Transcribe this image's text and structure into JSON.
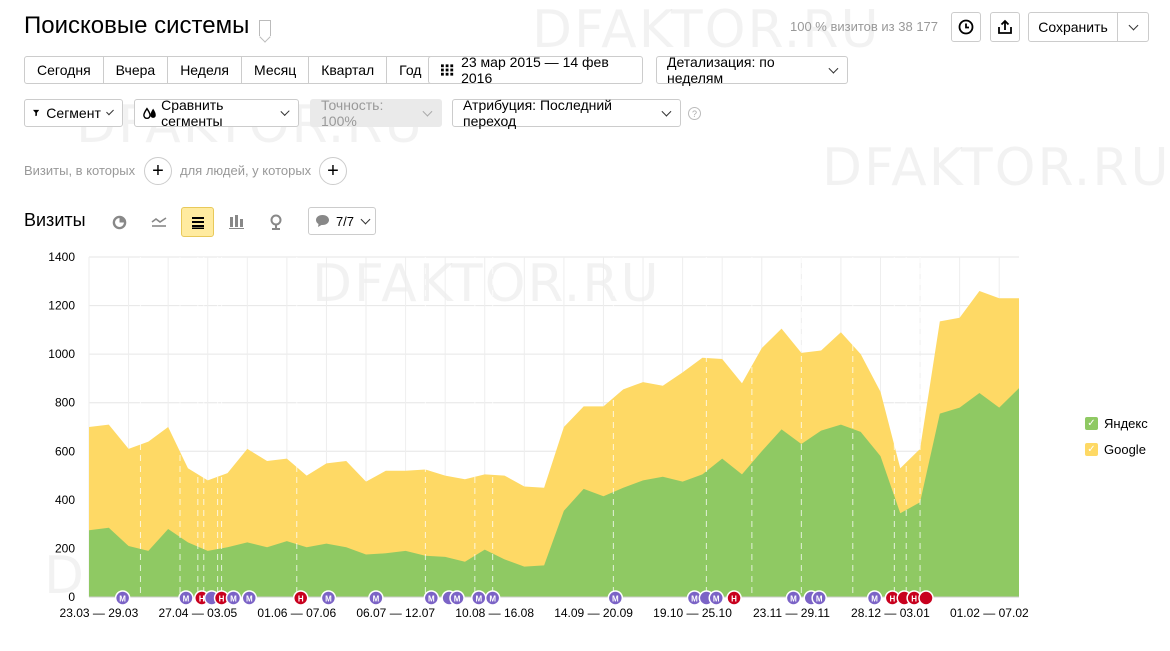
{
  "header": {
    "title": "Поисковые системы",
    "visits_note": "100 % визитов из 38 177",
    "save_label": "Сохранить"
  },
  "periods": [
    "Сегодня",
    "Вчера",
    "Неделя",
    "Месяц",
    "Квартал",
    "Год"
  ],
  "date_range": "23 мар 2015 — 14 фев 2016",
  "detail": "Детализация: по неделям",
  "filters": {
    "segment": "Сегмент",
    "compare": "Сравнить сегменты",
    "accuracy": "Точность: 100%",
    "attribution": "Атрибуция: Последний переход"
  },
  "conditions": {
    "visits_label": "Визиты, в которых",
    "people_label": "для людей, у которых"
  },
  "chart_header": {
    "title": "Визиты",
    "annotations": "7/7"
  },
  "watermarks": [
    "DFAKTOR.RU",
    "DFAKTOR.RU",
    "DFAKTOR.RU",
    "DFAKTOR.RU",
    "DFAKTOR.RU",
    "DFAKTOR.RU"
  ],
  "chart_data": {
    "type": "area",
    "stacked": true,
    "ylim": [
      0,
      1400
    ],
    "yticks": [
      0,
      200,
      400,
      600,
      800,
      1000,
      1200,
      1400
    ],
    "x_tick_labels": [
      "23.03 — 29.03",
      "27.04 — 03.05",
      "01.06 — 07.06",
      "06.07 — 12.07",
      "10.08 — 16.08",
      "14.09 — 20.09",
      "19.10 — 25.10",
      "23.11 — 29.11",
      "28.12 — 03.01",
      "01.02 — 07.02"
    ],
    "series": [
      {
        "name": "Яндекс",
        "color": "#8fc963",
        "values": [
          275,
          285,
          210,
          190,
          280,
          225,
          190,
          205,
          225,
          205,
          230,
          205,
          220,
          205,
          175,
          180,
          190,
          170,
          165,
          145,
          195,
          155,
          125,
          130,
          355,
          445,
          415,
          450,
          480,
          495,
          475,
          505,
          570,
          505,
          600,
          690,
          630,
          685,
          710,
          680,
          580,
          345,
          390,
          755,
          780,
          840,
          780,
          860
        ]
      },
      {
        "name": "Google",
        "color": "#fed965",
        "values": [
          425,
          425,
          400,
          450,
          420,
          305,
          290,
          305,
          385,
          355,
          340,
          295,
          330,
          355,
          300,
          340,
          330,
          355,
          335,
          340,
          310,
          345,
          330,
          320,
          345,
          340,
          370,
          405,
          405,
          375,
          450,
          480,
          410,
          375,
          425,
          415,
          375,
          330,
          380,
          320,
          265,
          185,
          220,
          380,
          370,
          420,
          450,
          370
        ]
      }
    ],
    "annotation_markers": [
      {
        "week": 1.7,
        "letter": "М",
        "type": "М"
      },
      {
        "week": 4.9,
        "letter": "М",
        "type": "М"
      },
      {
        "week": 5.7,
        "letter": "Н",
        "type": "Н"
      },
      {
        "week": 6.2,
        "letter": "",
        "type": "М"
      },
      {
        "week": 6.7,
        "letter": "Н",
        "type": "Н"
      },
      {
        "week": 7.3,
        "letter": "М",
        "type": "М"
      },
      {
        "week": 8.1,
        "letter": "М",
        "type": "М"
      },
      {
        "week": 10.7,
        "letter": "Н",
        "type": "Н"
      },
      {
        "week": 12.1,
        "letter": "М",
        "type": "М"
      },
      {
        "week": 14.5,
        "letter": "М",
        "type": "М"
      },
      {
        "week": 17.3,
        "letter": "М",
        "type": "М"
      },
      {
        "week": 18.2,
        "letter": "",
        "type": "М"
      },
      {
        "week": 18.6,
        "letter": "М",
        "type": "М"
      },
      {
        "week": 19.7,
        "letter": "М",
        "type": "М"
      },
      {
        "week": 20.4,
        "letter": "М",
        "type": "М"
      },
      {
        "week": 26.6,
        "letter": "М",
        "type": "М"
      },
      {
        "week": 30.6,
        "letter": "М",
        "type": "М"
      },
      {
        "week": 31.2,
        "letter": "",
        "type": "М"
      },
      {
        "week": 31.7,
        "letter": "М",
        "type": "М"
      },
      {
        "week": 32.6,
        "letter": "Н",
        "type": "Н"
      },
      {
        "week": 35.6,
        "letter": "М",
        "type": "М"
      },
      {
        "week": 36.5,
        "letter": "",
        "type": "М"
      },
      {
        "week": 36.9,
        "letter": "М",
        "type": "М"
      },
      {
        "week": 39.7,
        "letter": "М",
        "type": "М"
      },
      {
        "week": 40.6,
        "letter": "Н",
        "type": "Н"
      },
      {
        "week": 41.2,
        "letter": "",
        "type": "Н"
      },
      {
        "week": 41.7,
        "letter": "Н",
        "type": "Н"
      },
      {
        "week": 42.3,
        "letter": "",
        "type": "Н"
      }
    ],
    "dashed_lines_weeks": [
      2.6,
      4.6,
      5.5,
      5.8,
      6.5,
      6.7,
      10.5,
      17.0,
      19.5,
      20.4,
      26.5,
      31.2,
      33.5,
      36.0,
      38.6,
      40.7,
      41.3,
      42.0
    ]
  }
}
